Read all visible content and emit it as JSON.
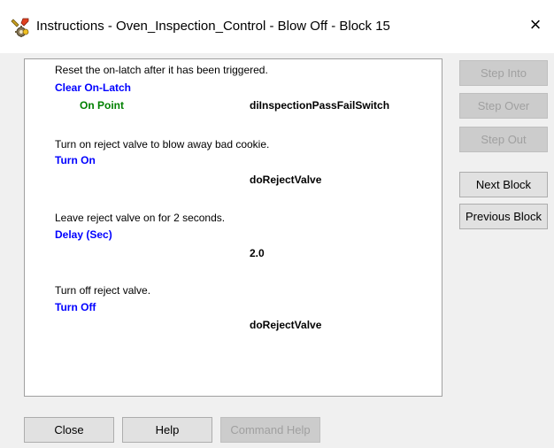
{
  "window": {
    "title": "Instructions - Oven_Inspection_Control - Blow Off - Block 15",
    "close_glyph": "×"
  },
  "instructions": [
    {
      "description": "Reset the on-latch after it has been triggered.",
      "command": "Clear On-Latch",
      "param_name": "On Point",
      "value": "diInspectionPassFailSwitch"
    },
    {
      "description": "Turn on reject valve to blow away bad cookie.",
      "command": "Turn On",
      "value": "doRejectValve"
    },
    {
      "description": "Leave reject valve on for 2 seconds.",
      "command": "Delay (Sec)",
      "value": "2.0"
    },
    {
      "description": "Turn off reject valve.",
      "command": "Turn Off",
      "value": "doRejectValve"
    }
  ],
  "side_buttons": {
    "step_into": "Step Into",
    "step_over": "Step Over",
    "step_out": "Step Out",
    "next_block": "Next Block",
    "previous_block": "Previous Block"
  },
  "bottom_buttons": {
    "close": "Close",
    "help": "Help",
    "command_help": "Command Help"
  },
  "colors": {
    "command": "#0000ff",
    "parameter": "#008000",
    "disabled_text": "#a0a0a0"
  },
  "icons": {
    "app": "gear-wrench-icon",
    "close": "close-icon"
  }
}
